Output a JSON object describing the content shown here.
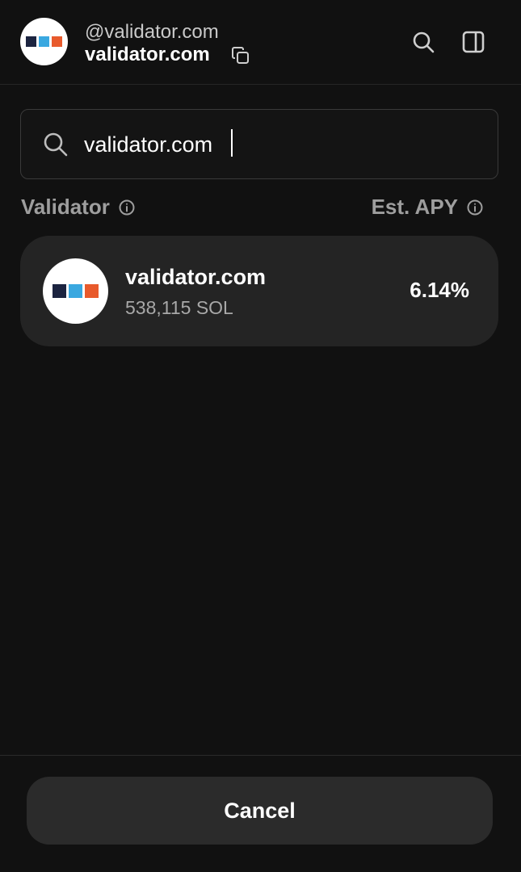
{
  "header": {
    "handle": "@validator.com",
    "name": "validator.com"
  },
  "logo_colors": [
    "#1c2440",
    "#3aa8e0",
    "#e85a2c"
  ],
  "search": {
    "value": "validator.com",
    "placeholder": ""
  },
  "columns": {
    "validator_label": "Validator",
    "apy_label": "Est. APY"
  },
  "validators": [
    {
      "name": "validator.com",
      "stake": "538,115 SOL",
      "apy": "6.14%"
    }
  ],
  "footer": {
    "cancel_label": "Cancel"
  },
  "icons": [
    "copy-icon",
    "search-icon",
    "sidebar-icon",
    "info-icon"
  ]
}
